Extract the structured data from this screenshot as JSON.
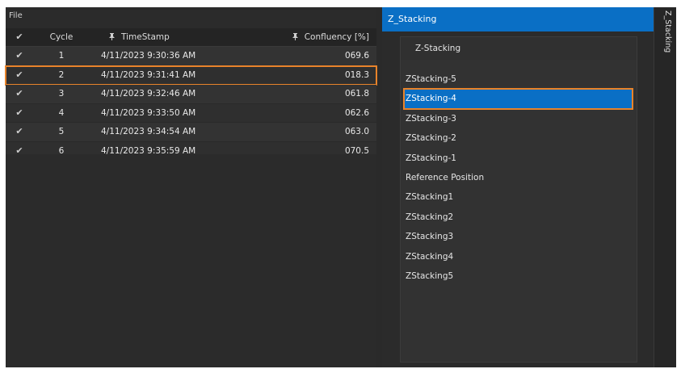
{
  "menu": {
    "file_label": "File"
  },
  "grid": {
    "headers": {
      "check": "✔",
      "cycle": "Cycle",
      "timestamp": "TimeStamp",
      "confluency": "Confluency [%]"
    },
    "rows": [
      {
        "check": "✔",
        "cycle": "1",
        "timestamp": "4/11/2023 9:30:36 AM",
        "confluency": "069.6"
      },
      {
        "check": "✔",
        "cycle": "2",
        "timestamp": "4/11/2023 9:31:41 AM",
        "confluency": "018.3"
      },
      {
        "check": "✔",
        "cycle": "3",
        "timestamp": "4/11/2023 9:32:46 AM",
        "confluency": "061.8"
      },
      {
        "check": "✔",
        "cycle": "4",
        "timestamp": "4/11/2023 9:33:50 AM",
        "confluency": "062.6"
      },
      {
        "check": "✔",
        "cycle": "5",
        "timestamp": "4/11/2023 9:34:54 AM",
        "confluency": "063.0"
      },
      {
        "check": "✔",
        "cycle": "6",
        "timestamp": "4/11/2023 9:35:59 AM",
        "confluency": "070.5"
      }
    ]
  },
  "panel": {
    "title": "Z_Stacking",
    "list_title": "Z-Stacking",
    "items": [
      "ZStacking-5",
      "ZStacking-4",
      "ZStacking-3",
      "ZStacking-2",
      "ZStacking-1",
      "Reference Position",
      "ZStacking1",
      "ZStacking2",
      "ZStacking3",
      "ZStacking4",
      "ZStacking5"
    ],
    "selected": "ZStacking-4"
  },
  "side_tab": {
    "label": "Z_Stacking"
  },
  "colors": {
    "accent": "#0a6fc5",
    "highlight": "#e8832a",
    "background": "#2b2b2b"
  }
}
